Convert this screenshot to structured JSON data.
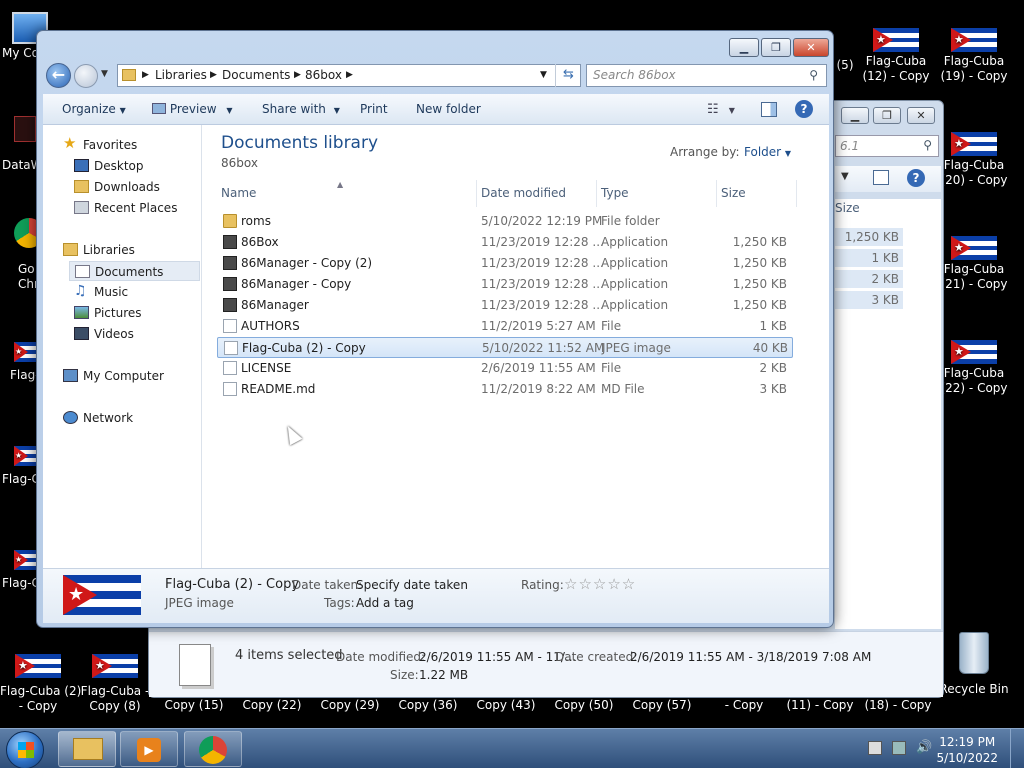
{
  "desktop": {
    "icons_left": [
      {
        "label": "My Co",
        "kind": "computer"
      },
      {
        "label": "DataW",
        "kind": "app"
      },
      {
        "label": "Go\nChr",
        "kind": "chrome"
      },
      {
        "label": "Flag-",
        "kind": "flag"
      },
      {
        "label": "Flag-C",
        "kind": "flag"
      },
      {
        "label": "Flag-C",
        "kind": "flag"
      }
    ],
    "icons_right": [
      {
        "label": "(5)",
        "kind": "flag"
      },
      {
        "label": "Flag-Cuba\n(12) - Copy",
        "kind": "flag"
      },
      {
        "label": "Flag-Cuba\n(19) - Copy",
        "kind": "flag"
      },
      {
        "label": "Flag-Cuba\n(20) - Copy",
        "kind": "flag"
      },
      {
        "label": "Flag-Cuba\n(21) - Copy",
        "kind": "flag"
      },
      {
        "label": "Flag-Cuba\n(22) - Copy",
        "kind": "flag"
      },
      {
        "label": "Recycle Bin",
        "kind": "recycle"
      }
    ],
    "bottom_row": [
      {
        "label": "Flag-Cuba (2)\n- Copy"
      },
      {
        "label": "Flag-Cuba -\nCopy (8)"
      },
      {
        "label": "Copy (15)"
      },
      {
        "label": "Copy (22)"
      },
      {
        "label": "Copy (29)"
      },
      {
        "label": "Copy (36)"
      },
      {
        "label": "Copy (43)"
      },
      {
        "label": "Copy (50)"
      },
      {
        "label": "Copy (57)"
      },
      {
        "label": "- Copy"
      },
      {
        "label": "(11) - Copy"
      },
      {
        "label": "(18) - Copy"
      }
    ]
  },
  "bg_window": {
    "search_fragment": "6.1",
    "size_header": "Size",
    "sizes": [
      "1,250 KB",
      "1 KB",
      "2 KB",
      "3 KB"
    ],
    "details": {
      "selected": "4 items selected",
      "date_modified_label": "Date modified:",
      "date_modified_value": "2/6/2019 11:55 AM - 11/...",
      "date_created_label": "Date created:",
      "date_created_value": "2/6/2019 11:55 AM - 3/18/2019 7:08 AM",
      "size_label": "Size:",
      "size_value": "1.22 MB"
    }
  },
  "explorer": {
    "breadcrumb": [
      "Libraries",
      "Documents",
      "86box"
    ],
    "search_placeholder": "Search 86box",
    "toolbar": {
      "organize": "Organize",
      "preview": "Preview",
      "share_with": "Share with",
      "print": "Print",
      "new_folder": "New folder"
    },
    "nav": {
      "favorites": "Favorites",
      "desktop": "Desktop",
      "downloads": "Downloads",
      "recent_places": "Recent Places",
      "libraries": "Libraries",
      "documents": "Documents",
      "music": "Music",
      "pictures": "Pictures",
      "videos": "Videos",
      "my_computer": "My Computer",
      "network": "Network"
    },
    "library_title": "Documents library",
    "library_subtitle": "86box",
    "arrange_label": "Arrange by:",
    "arrange_value": "Folder",
    "columns": {
      "name": "Name",
      "date": "Date modified",
      "type": "Type",
      "size": "Size"
    },
    "files": [
      {
        "name": "roms",
        "date": "5/10/2022 12:19 PM",
        "type": "File folder",
        "size": "",
        "icon": "folder"
      },
      {
        "name": "86Box",
        "date": "11/23/2019 12:28 ...",
        "type": "Application",
        "size": "1,250 KB",
        "icon": "app"
      },
      {
        "name": "86Manager - Copy (2)",
        "date": "11/23/2019 12:28 ...",
        "type": "Application",
        "size": "1,250 KB",
        "icon": "app"
      },
      {
        "name": "86Manager - Copy",
        "date": "11/23/2019 12:28 ...",
        "type": "Application",
        "size": "1,250 KB",
        "icon": "app"
      },
      {
        "name": "86Manager",
        "date": "11/23/2019 12:28 ...",
        "type": "Application",
        "size": "1,250 KB",
        "icon": "app"
      },
      {
        "name": "AUTHORS",
        "date": "11/2/2019 5:27 AM",
        "type": "File",
        "size": "1 KB",
        "icon": "file"
      },
      {
        "name": "Flag-Cuba (2) - Copy",
        "date": "5/10/2022 11:52 AM",
        "type": "JPEG image",
        "size": "40 KB",
        "icon": "jpg"
      },
      {
        "name": "LICENSE",
        "date": "2/6/2019 11:55 AM",
        "type": "File",
        "size": "2 KB",
        "icon": "file"
      },
      {
        "name": "README.md",
        "date": "11/2/2019 8:22 AM",
        "type": "MD File",
        "size": "3 KB",
        "icon": "file"
      }
    ],
    "details_pane": {
      "name": "Flag-Cuba (2) - Copy",
      "type": "JPEG image",
      "date_taken_label": "Date taken:",
      "date_taken_value": "Specify date taken",
      "tags_label": "Tags:",
      "tags_value": "Add a tag",
      "rating_label": "Rating:",
      "rating_stars": "☆☆☆☆☆",
      "rating_value": 0
    }
  },
  "taskbar": {
    "time": "12:19 PM",
    "date": "5/10/2022"
  },
  "colors": {
    "accent_title": "#1e4f8c",
    "selection": "#d4e5f8",
    "flag_blue": "#0b3fa8",
    "flag_red": "#d01818"
  }
}
